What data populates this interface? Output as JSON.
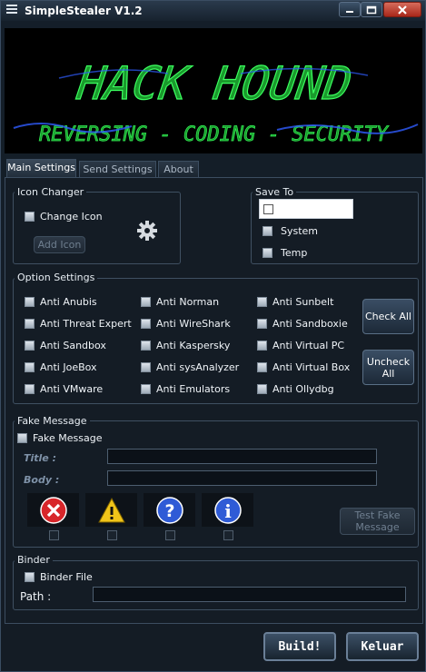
{
  "window": {
    "title": "SimpleStealer V1.2"
  },
  "banner": {
    "headline": "HACK HOUND",
    "tagline": "REVERSING - CODING - SECURITY"
  },
  "tabs": [
    {
      "label": "Main Settings",
      "active": true
    },
    {
      "label": "Send Settings",
      "active": false
    },
    {
      "label": "About",
      "active": false
    }
  ],
  "icon_changer": {
    "title": "Icon Changer",
    "change_icon_label": "Change Icon",
    "change_icon_checked": false,
    "add_icon_label": "Add Icon",
    "preview_icon": "gear-icon"
  },
  "save_to": {
    "title": "Save To",
    "options": [
      {
        "label": "",
        "checked": false
      },
      {
        "label": "System",
        "checked": false
      },
      {
        "label": "Temp",
        "checked": false
      }
    ]
  },
  "option_settings": {
    "title": "Option Settings",
    "col1": [
      "Anti Anubis",
      "Anti Threat Expert",
      "Anti Sandbox",
      "Anti JoeBox",
      "Anti VMware"
    ],
    "col2": [
      "Anti Norman",
      "Anti WireShark",
      "Anti Kaspersky",
      "Anti sysAnalyzer",
      "Anti Emulators"
    ],
    "col3": [
      "Anti Sunbelt",
      "Anti Sandboxie",
      "Anti Virtual PC",
      "Anti Virtual Box",
      "Anti Ollydbg"
    ],
    "check_all_label": "Check All",
    "uncheck_all_label": "Uncheck All"
  },
  "fake_message": {
    "title": "Fake Message",
    "enable_label": "Fake Message",
    "title_label": "Title :",
    "body_label": "Body :",
    "title_value": "",
    "body_value": "",
    "icons": [
      "error-icon",
      "warning-icon",
      "question-icon",
      "info-icon"
    ],
    "test_label": "Test Fake Message"
  },
  "binder": {
    "title": "Binder",
    "enable_label": "Binder File",
    "path_label": "Path :",
    "path_value": ""
  },
  "actions": {
    "build_label": "Build!",
    "exit_label": "Keluar"
  },
  "colors": {
    "banner_green": "#22e04a",
    "banner_blue": "#2f5cff",
    "accent": "#3a4e64"
  }
}
